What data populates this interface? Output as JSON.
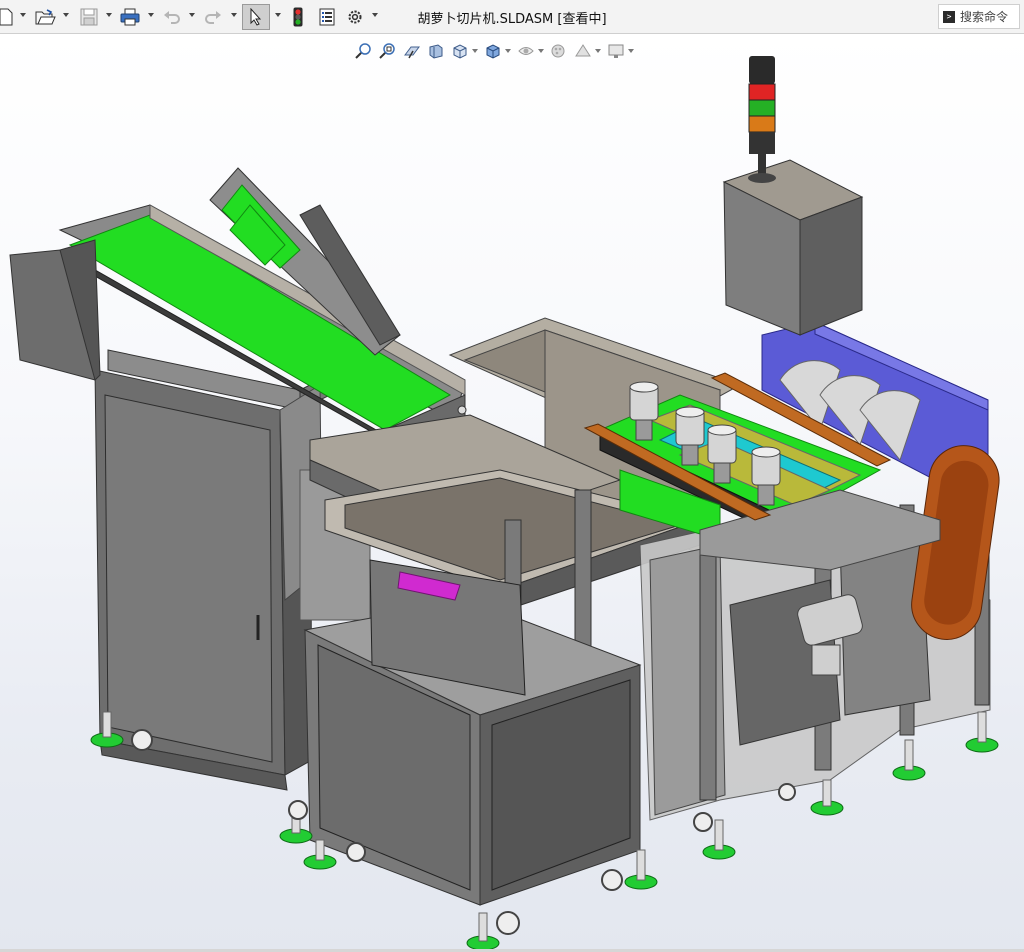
{
  "window": {
    "title": "胡萝卜切片机.SLDASM [查看中]"
  },
  "toolbar": {
    "search_label": "搜索命令",
    "icons": [
      "new-document-icon",
      "open-folder-icon",
      "save-icon",
      "print-icon",
      "undo-icon",
      "redo-icon",
      "select-arrow-icon",
      "traffic-light-icon",
      "file-properties-icon",
      "gear-icon"
    ]
  },
  "heads_up_toolbar": {
    "icons": [
      "zoom-to-fit-icon",
      "zoom-to-area-icon",
      "previous-view-icon",
      "section-view-icon",
      "view-orientation-icon",
      "display-style-icon",
      "hide-show-items-icon",
      "edit-appearance-icon",
      "apply-scene-icon",
      "view-settings-icon"
    ]
  },
  "colors": {
    "belt": "#22dd22",
    "frame": "#6b6b6b",
    "guard": "#5b5bd6",
    "bracket": "#c06a22",
    "cover": "#b5561a",
    "feet": "#22cc33"
  }
}
